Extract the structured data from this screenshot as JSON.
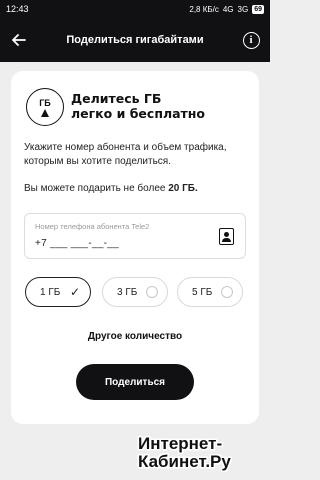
{
  "status_bar": {
    "time": "12:43",
    "network_speed": "2,8 КБ/с",
    "network": "4G",
    "network2": "3G",
    "battery": "69"
  },
  "app_bar": {
    "title": "Поделиться гигабайтами",
    "back_icon": "arrow-left-icon",
    "info_icon": "info-icon"
  },
  "card": {
    "icon_label": "ГБ",
    "headline_line1": "Делитесь ГБ",
    "headline_line2": "легко и бесплатно",
    "description": "Укажите номер абонента и объем трафика, которым вы хотите поделиться.",
    "limit_prefix": "Вы можете подарить не более ",
    "limit_value": "20 ГБ.",
    "phone_field": {
      "placeholder": "Номер телефона абонента Tele2",
      "value": "+7 ___ ___-__-__"
    },
    "options": [
      {
        "label": "1 ГБ",
        "selected": true
      },
      {
        "label": "3 ГБ",
        "selected": false
      },
      {
        "label": "5 ГБ",
        "selected": false
      }
    ],
    "other_amount_label": "Другое количество",
    "share_button_label": "Поделиться"
  },
  "watermark": {
    "line1": "Интернет-",
    "line2": "Кабинет.Ру"
  },
  "colors": {
    "dark": "#111114",
    "background": "#eeeeee",
    "card": "#ffffff"
  }
}
